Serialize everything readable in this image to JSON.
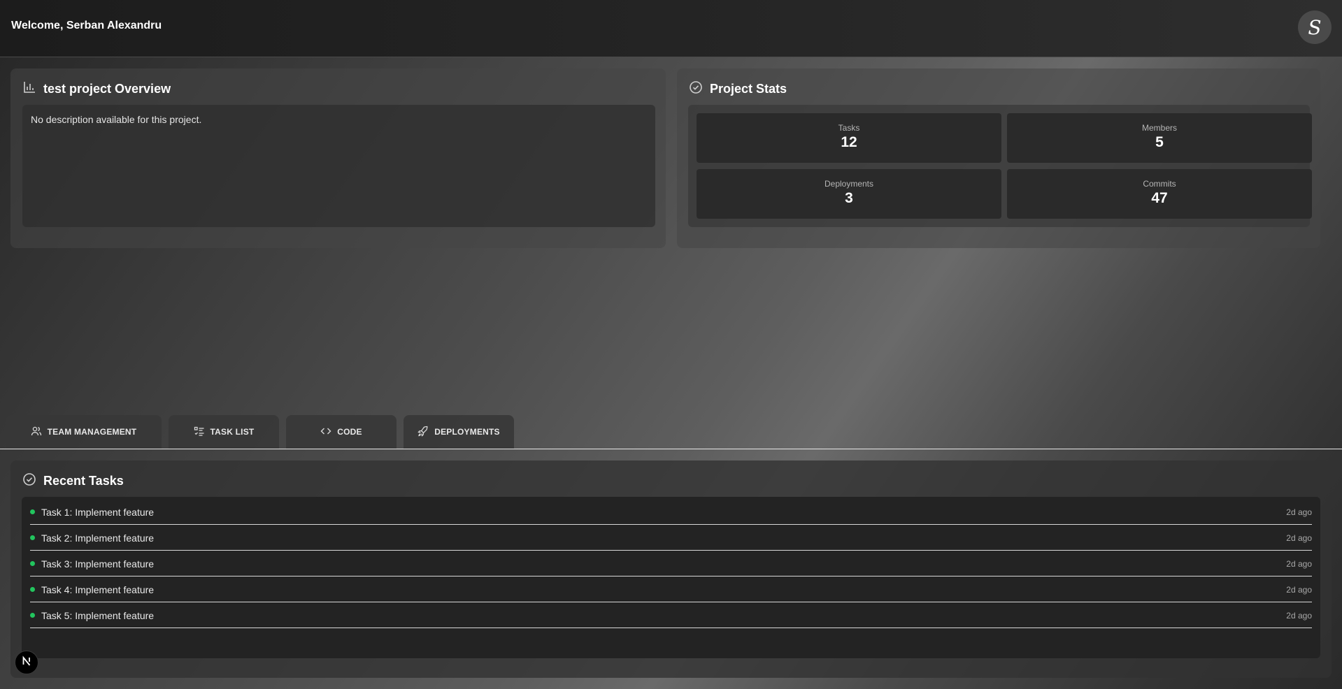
{
  "header": {
    "welcome": "Welcome, Serban Alexandru",
    "avatar_letter": "S"
  },
  "overview": {
    "title": "test project Overview",
    "icon": "bar-chart-icon",
    "description": "No description available for this project."
  },
  "stats": {
    "title": "Project Stats",
    "icon": "check-circle-icon",
    "items": [
      {
        "label": "Tasks",
        "value": "12"
      },
      {
        "label": "Members",
        "value": "5"
      },
      {
        "label": "Deployments",
        "value": "3"
      },
      {
        "label": "Commits",
        "value": "47"
      }
    ]
  },
  "tabs": [
    {
      "label": "TEAM MANAGEMENT",
      "icon": "users-icon"
    },
    {
      "label": "TASK LIST",
      "icon": "list-checks-icon"
    },
    {
      "label": "CODE",
      "icon": "code-icon"
    },
    {
      "label": "DEPLOYMENTS",
      "icon": "rocket-icon"
    }
  ],
  "recent_tasks": {
    "title": "Recent Tasks",
    "icon": "check-circle-icon",
    "items": [
      {
        "name": "Task 1: Implement feature",
        "time": "2d ago"
      },
      {
        "name": "Task 2: Implement feature",
        "time": "2d ago"
      },
      {
        "name": "Task 3: Implement feature",
        "time": "2d ago"
      },
      {
        "name": "Task 4: Implement feature",
        "time": "2d ago"
      },
      {
        "name": "Task 5: Implement feature",
        "time": "2d ago"
      }
    ]
  },
  "dev_badge": {
    "letter": "N",
    "icon": "nextjs-icon"
  },
  "colors": {
    "status_dot": "#22c55e",
    "stat_box": "#2a2a2a"
  }
}
